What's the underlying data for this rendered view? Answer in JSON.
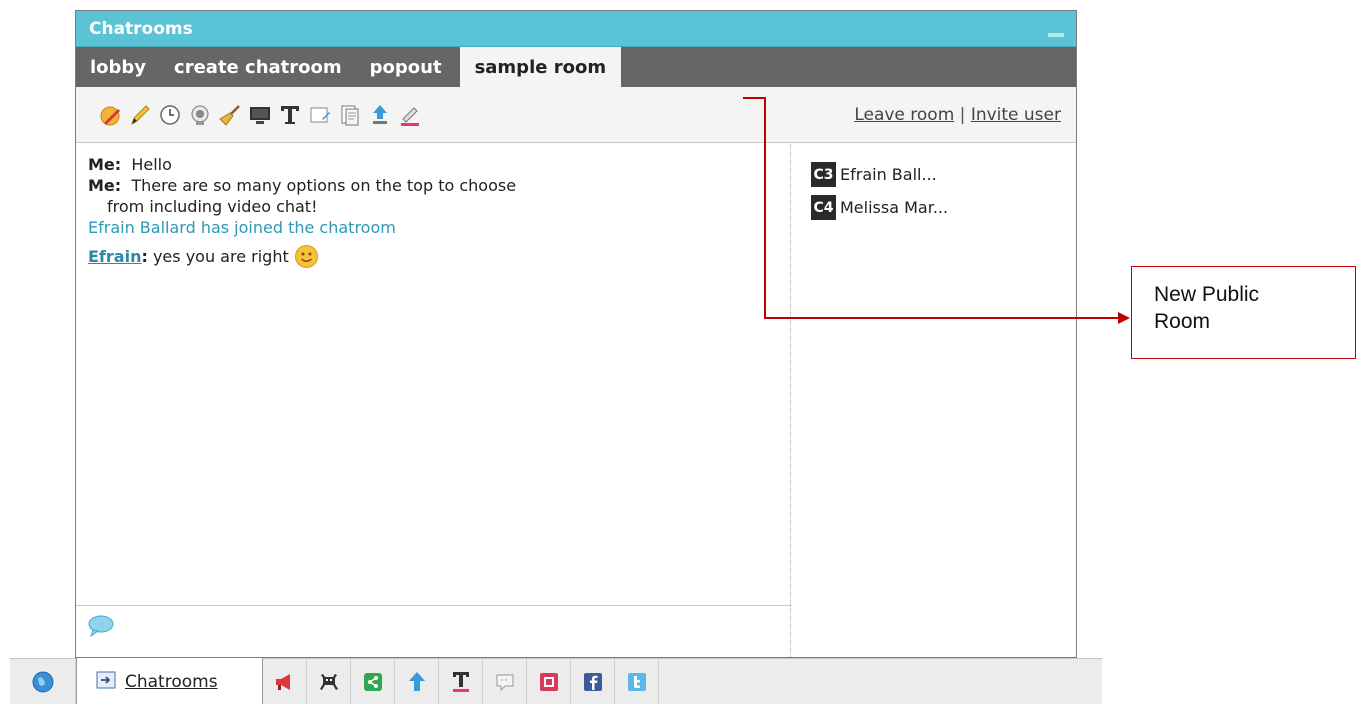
{
  "window": {
    "title": "Chatrooms"
  },
  "tabs": [
    {
      "label": "lobby"
    },
    {
      "label": "create chatroom"
    },
    {
      "label": "popout"
    },
    {
      "label": "sample room",
      "active": true
    }
  ],
  "toolbar": {
    "icons": [
      "smiley-icon",
      "pencil-icon",
      "clock-icon",
      "webcam-icon",
      "broom-icon",
      "screen-share-icon",
      "text-format-icon",
      "whiteboard-icon",
      "document-icon",
      "upload-icon",
      "color-picker-icon"
    ],
    "leave_room": "Leave room",
    "separator": "|",
    "invite_user": "Invite user"
  },
  "messages": [
    {
      "sender": "Me:",
      "text": "Hello"
    },
    {
      "sender": "Me:",
      "text": "There are so many options on the top to choose",
      "continuation": "from including video chat!"
    },
    {
      "system": "Efrain Ballard has joined the chatroom"
    },
    {
      "sender": "Efrain",
      "colon": ":",
      "text": "yes you are right"
    }
  ],
  "users": [
    {
      "badge": "C3",
      "name": "Efrain Ball..."
    },
    {
      "badge": "C4",
      "name": "Melissa Mar..."
    }
  ],
  "callout": {
    "line1": "New Public",
    "line2": "Room",
    "color": "#c00000"
  },
  "bottombar": {
    "chatrooms_label": "Chatrooms",
    "icons": [
      "globe-icon",
      "announcement-icon",
      "games-icon",
      "share-icon",
      "upload-arrow-icon",
      "text-icon",
      "broadcast-icon",
      "bookmark-icon",
      "facebook-icon",
      "twitter-icon"
    ]
  },
  "colors": {
    "titlebar": "#5bc3d6",
    "tabbar": "#666666",
    "system_text": "#2a9ab8"
  }
}
